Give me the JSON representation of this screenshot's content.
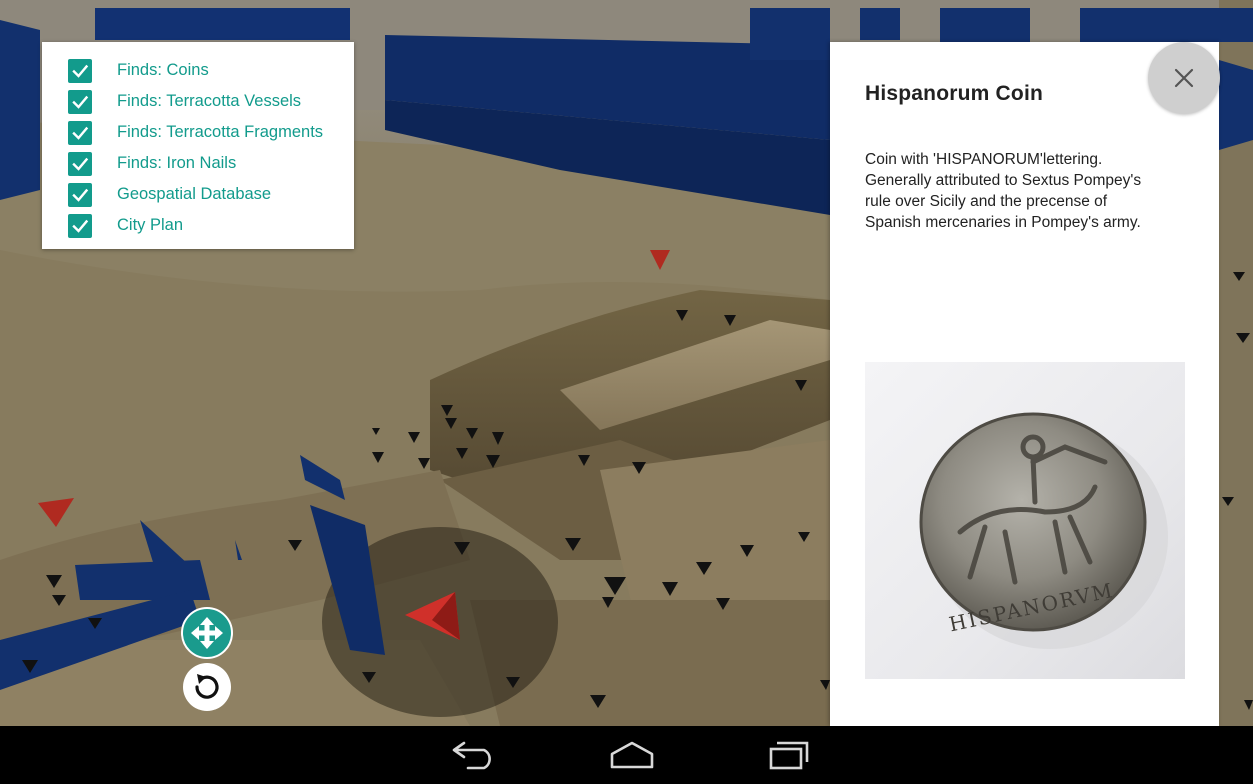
{
  "layers": {
    "items": [
      {
        "label": "Finds: Coins",
        "checked": true
      },
      {
        "label": "Finds: Terracotta Vessels",
        "checked": true
      },
      {
        "label": "Finds: Terracotta Fragments",
        "checked": true
      },
      {
        "label": "Finds: Iron Nails",
        "checked": true
      },
      {
        "label": "Geospatial Database",
        "checked": true
      },
      {
        "label": "City Plan",
        "checked": true
      }
    ]
  },
  "info": {
    "title": "Hispanorum Coin",
    "description": "Coin with 'HISPANORUM'lettering. Generally attributed to Sextus Pompey's rule over Sicily and the precense of Spanish mercenaries in Pompey's army.",
    "coin_inscription": "HISPANORVM",
    "image_icon": "coin-photo"
  },
  "controls": {
    "close_icon": "close-icon",
    "pan_icon": "move-arrows-icon",
    "rotate_icon": "rotate-icon"
  },
  "nav": {
    "back_icon": "back-icon",
    "home_icon": "home-icon",
    "recents_icon": "recents-icon"
  },
  "colors": {
    "accent": "#129b8c",
    "wall_blue": "#0f2a5e",
    "marker_red": "#c4261e",
    "marker_black": "#111111"
  }
}
